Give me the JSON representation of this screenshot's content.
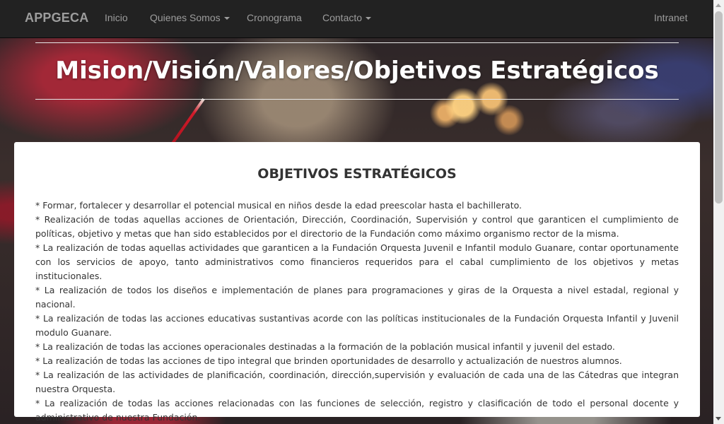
{
  "navbar": {
    "brand": "APPGECA",
    "items": [
      {
        "label": "Inicio",
        "dropdown": false
      },
      {
        "label": "Quienes Somos",
        "dropdown": true
      },
      {
        "label": "Cronograma",
        "dropdown": false
      },
      {
        "label": "Contacto",
        "dropdown": true
      }
    ],
    "right_item": "Intranet"
  },
  "header": {
    "title": "Mision/Visión/Valores/Objetivos Estratégicos"
  },
  "section": {
    "title": "OBJETIVOS ESTRATÉGICOS",
    "objectives": [
      "* Formar, fortalecer y desarrollar el potencial musical en niños desde la edad preescolar hasta el bachillerato.",
      "* Realización de todas aquellas acciones de Orientación, Dirección, Coordinación, Supervisión y control que garanticen el cumplimiento de políticas, objetivo y metas que han sido establecidos por el directorio de la Fundación como máximo organismo rector de la misma.",
      "* La realización de todas aquellas actividades que garanticen a la Fundación Orquesta Juvenil e Infantil modulo Guanare, contar oportunamente con los servicios de apoyo, tanto administrativos como financieros requeridos para el cabal cumplimiento de los objetivos y metas institucionales.",
      "* La realización de todos los diseños e implementación de planes para programaciones y giras de la Orquesta a nivel estadal, regional y nacional.",
      "* La realización de todas las acciones educativas sustantivas acorde con las políticas institucionales de la Fundación Orquesta Infantil y Juvenil modulo Guanare.",
      "* La realización de todas las acciones operacionales destinadas a la formación de la población musical infantil y juvenil del estado.",
      "* La realización de todas las acciones de tipo integral que brinden oportunidades de desarrollo y actualización de nuestros alumnos.",
      "* La realización de las actividades de planificación, coordinación, dirección,supervisión y evaluación de cada una de las Cátedras que integran nuestra Orquesta.",
      "* La realización de todas las acciones relacionadas con las funciones de selección, registro y clasificación de todo el personal docente y administrativo de nuestra Fundación."
    ]
  },
  "icons": [
    "caret-down-icon",
    "scroll-up-arrow-icon",
    "scroll-down-arrow-icon"
  ],
  "colors": {
    "navbar_bg": "#222222",
    "navbar_text": "#9d9d9d",
    "card_bg": "#ffffff",
    "title_text": "#ffffff"
  }
}
